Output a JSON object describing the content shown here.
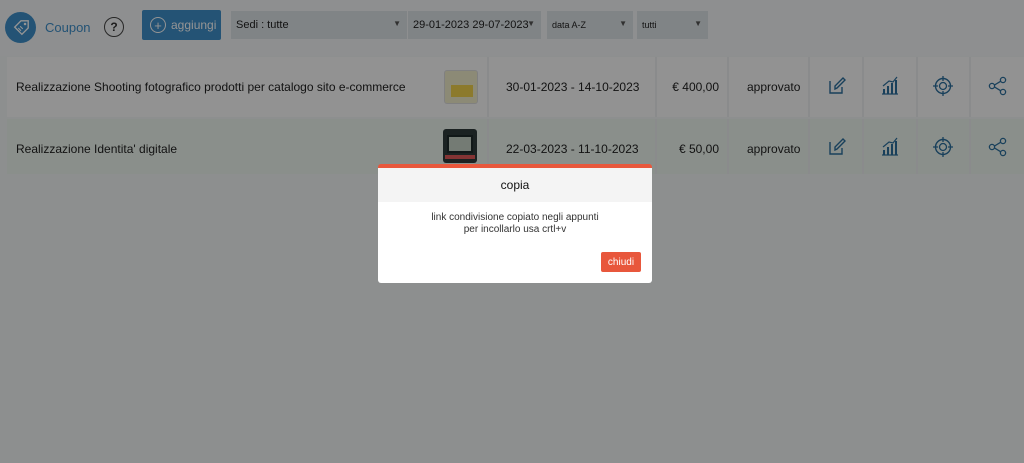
{
  "header": {
    "app_title": "Coupon",
    "help_icon": "question-circle-icon",
    "add_label": "aggiungi",
    "filters": {
      "sedi": "Sedi : tutte",
      "date_range": "29-01-2023 29-07-2023",
      "order": "data A-Z",
      "stato": "tutti"
    }
  },
  "rows": [
    {
      "title": "Realizzazione Shooting fotografico prodotti per catalogo sito e-commerce",
      "dates": "30-01-2023 - 14-10-2023",
      "price": "€ 400,00",
      "status": "approvato"
    },
    {
      "title": "Realizzazione Identita' digitale",
      "dates": "22-03-2023 - 11-10-2023",
      "price": "€ 50,00",
      "status": "approvato"
    }
  ],
  "actions": [
    "edit-icon",
    "stats-icon",
    "target-icon",
    "share-icon"
  ],
  "modal": {
    "title": "copia",
    "line1": "link condivisione copiato negli appunti",
    "line2": "per incollarlo usa crtl+v",
    "close_label": "chiudi"
  },
  "colors": {
    "accent": "#3e8fca",
    "modal_accent": "#e8573c"
  }
}
